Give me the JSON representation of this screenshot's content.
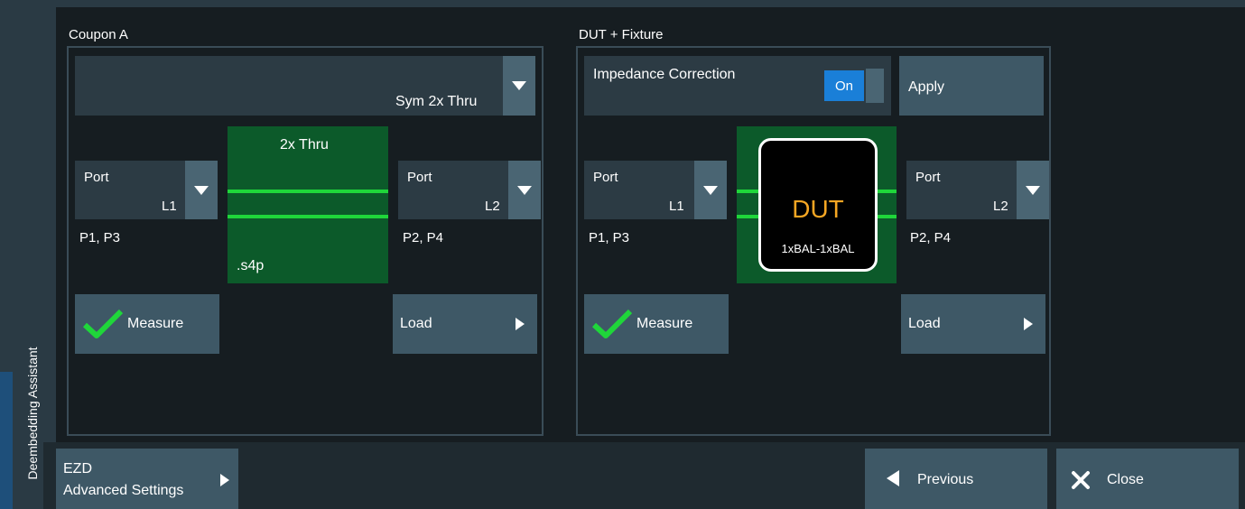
{
  "sidebar": {
    "title": "Deembedding Assistant"
  },
  "coupon": {
    "title": "Coupon A",
    "mode_value": "Sym 2x Thru",
    "left_port": {
      "label": "Port",
      "value": "L1",
      "sub": "P1, P3"
    },
    "right_port": {
      "label": "Port",
      "value": "L2",
      "sub": "P2, P4"
    },
    "graphic": {
      "title": "2x Thru",
      "file": ".s4p"
    },
    "measure_label": "Measure",
    "load_label": "Load"
  },
  "dut": {
    "title": "DUT + Fixture",
    "impedance_label": "Impedance Correction",
    "toggle_value": "On",
    "apply_label": "Apply",
    "left_port": {
      "label": "Port",
      "value": "L1",
      "sub": "P1, P3"
    },
    "right_port": {
      "label": "Port",
      "value": "L2",
      "sub": "P2, P4"
    },
    "graphic": {
      "title": "DUT",
      "subtitle": "1xBAL-1xBAL"
    },
    "measure_label": "Measure",
    "load_label": "Load"
  },
  "footer": {
    "ezd_line1": "EZD",
    "ezd_line2": "Advanced Settings",
    "previous_label": "Previous",
    "close_label": "Close"
  },
  "colors": {
    "accent_green": "#1fd63a",
    "dut_orange": "#f5a623",
    "toggle_blue": "#1a7fd8"
  }
}
